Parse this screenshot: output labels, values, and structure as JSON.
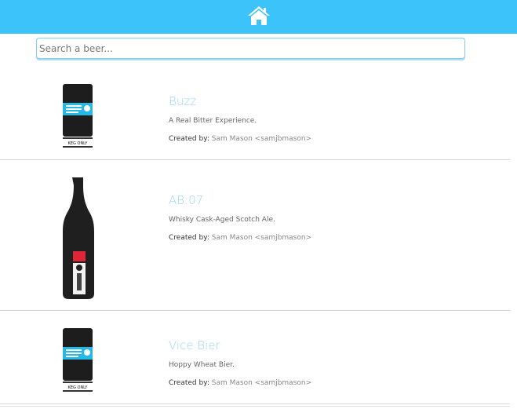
{
  "header": {
    "home_icon": "home-icon",
    "background": "#3cc3fa"
  },
  "search": {
    "placeholder": "Search a beer...",
    "value": ""
  },
  "beers": [
    {
      "name": "Buzz",
      "tagline": "A Real Bitter Experience.",
      "created_by_label": "Created by:",
      "creator": "Sam Mason <samjbmason>",
      "image": "keg-icon",
      "image_label": "KEG ONLY"
    },
    {
      "name": "AB:07",
      "tagline": "Whisky Cask-Aged Scotch Ale.",
      "created_by_label": "Created by:",
      "creator": "Sam Mason <samjbmason>",
      "image": "bottle-icon"
    },
    {
      "name": "Vice Bier",
      "tagline": "Hoppy Wheat Bier.",
      "created_by_label": "Created by:",
      "creator": "Sam Mason <samjbmason>",
      "image": "keg-icon",
      "image_label": "KEG ONLY"
    }
  ],
  "colors": {
    "accent": "#3cc3fa",
    "beer_name": "#9cd3f2"
  }
}
